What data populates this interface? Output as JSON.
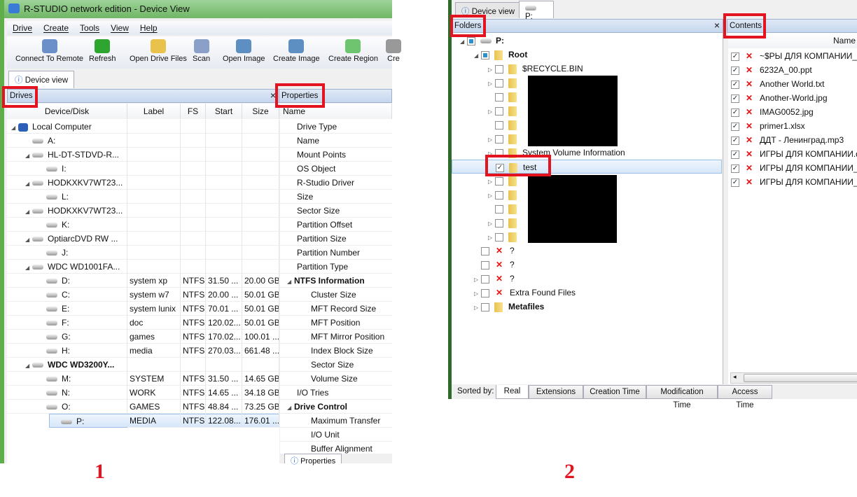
{
  "left": {
    "title": "R-STUDIO network edition - Device View",
    "menu": [
      "Drive",
      "Create",
      "Tools",
      "View",
      "Help"
    ],
    "toolbar": [
      "Connect To Remote",
      "Refresh",
      "Open Drive Files",
      "Scan",
      "Open Image",
      "Create Image",
      "Create Region",
      "Cre"
    ],
    "tab": "Device view",
    "drives_title": "Drives",
    "close": "×",
    "columns": [
      "Device/Disk",
      "Label",
      "FS",
      "Start",
      "Size"
    ],
    "drives": [
      {
        "name": "Local Computer",
        "level": 0,
        "type": "pc",
        "exp": true
      },
      {
        "name": "A:",
        "level": 1,
        "type": "hdd"
      },
      {
        "name": "HL-DT-STDVD-R...",
        "level": 1,
        "type": "hdd",
        "exp": true
      },
      {
        "name": "I:",
        "level": 2,
        "type": "cd"
      },
      {
        "name": "HODKXKV7WT23...",
        "level": 1,
        "type": "hdd",
        "exp": true
      },
      {
        "name": "L:",
        "level": 2,
        "type": "cd"
      },
      {
        "name": "HODKXKV7WT23...",
        "level": 1,
        "type": "hdd",
        "exp": true
      },
      {
        "name": "K:",
        "level": 2,
        "type": "cd"
      },
      {
        "name": "OptiarcDVD RW ...",
        "level": 1,
        "type": "hdd",
        "exp": true
      },
      {
        "name": "J:",
        "level": 2,
        "type": "cd"
      },
      {
        "name": "WDC WD1001FA...",
        "level": 1,
        "type": "hdd",
        "exp": true
      },
      {
        "name": "D:",
        "level": 2,
        "type": "hdd",
        "label": "system xp",
        "fs": "NTFS",
        "start": "31.50 ...",
        "size": "20.00 GB"
      },
      {
        "name": "C:",
        "level": 2,
        "type": "hdd",
        "label": "system w7",
        "fs": "NTFS",
        "start": "20.00 ...",
        "size": "50.01 GB"
      },
      {
        "name": "E:",
        "level": 2,
        "type": "hdd",
        "label": "system lunix",
        "fs": "NTFS",
        "start": "70.01 ...",
        "size": "50.01 GB"
      },
      {
        "name": "F:",
        "level": 2,
        "type": "hdd",
        "label": "doc",
        "fs": "NTFS",
        "start": "120.02...",
        "size": "50.01 GB"
      },
      {
        "name": "G:",
        "level": 2,
        "type": "hdd",
        "label": "games",
        "fs": "NTFS",
        "start": "170.02...",
        "size": "100.01 ..."
      },
      {
        "name": "H:",
        "level": 2,
        "type": "hdd",
        "label": "media",
        "fs": "NTFS",
        "start": "270.03...",
        "size": "661.48 ..."
      },
      {
        "name": "WDC WD3200Y...",
        "level": 1,
        "type": "hdd",
        "exp": true,
        "bold": true
      },
      {
        "name": "M:",
        "level": 2,
        "type": "hdd",
        "label": "SYSTEM",
        "fs": "NTFS",
        "start": "31.50 ...",
        "size": "14.65 GB"
      },
      {
        "name": "N:",
        "level": 2,
        "type": "hdd",
        "label": "WORK",
        "fs": "NTFS",
        "start": "14.65 ...",
        "size": "34.18 GB"
      },
      {
        "name": "O:",
        "level": 2,
        "type": "hdd",
        "label": "GAMES",
        "fs": "NTFS",
        "start": "48.84 ...",
        "size": "73.25 GB"
      },
      {
        "name": "P:",
        "level": 2,
        "type": "hdd",
        "label": "MEDIA",
        "fs": "NTFS",
        "start": "122.08...",
        "size": "176.01 ...",
        "selected": true
      }
    ],
    "properties_title": "Properties",
    "properties_col": "Name",
    "properties": [
      {
        "name": "Drive Type",
        "level": 1
      },
      {
        "name": "Name",
        "level": 1
      },
      {
        "name": "Mount Points",
        "level": 1
      },
      {
        "name": "OS Object",
        "level": 1
      },
      {
        "name": "R-Studio Driver",
        "level": 1
      },
      {
        "name": "Size",
        "level": 1
      },
      {
        "name": "Sector Size",
        "level": 1
      },
      {
        "name": "Partition Offset",
        "level": 1
      },
      {
        "name": "Partition Size",
        "level": 1
      },
      {
        "name": "Partition Number",
        "level": 1
      },
      {
        "name": "Partition Type",
        "level": 1
      },
      {
        "name": "NTFS Information",
        "level": 0,
        "bold": true
      },
      {
        "name": "Cluster Size",
        "level": 2
      },
      {
        "name": "MFT Record Size",
        "level": 2
      },
      {
        "name": "MFT Position",
        "level": 2
      },
      {
        "name": "MFT Mirror Position",
        "level": 2
      },
      {
        "name": "Index Block Size",
        "level": 2
      },
      {
        "name": "Sector Size",
        "level": 2
      },
      {
        "name": "Volume Size",
        "level": 2
      },
      {
        "name": "I/O Tries",
        "level": 1
      },
      {
        "name": "Drive Control",
        "level": 0,
        "bold": true
      },
      {
        "name": "Maximum Transfer",
        "level": 2
      },
      {
        "name": "I/O Unit",
        "level": 2
      },
      {
        "name": "Buffer Alignment",
        "level": 2
      }
    ],
    "bottom_tab": "Properties",
    "figure_number": "1"
  },
  "right": {
    "tabs": [
      "Device view",
      "P:"
    ],
    "folders_title": "Folders",
    "close": "×",
    "tree": [
      {
        "name": "P:",
        "level": 0,
        "icon": "hdd",
        "chk": "partial",
        "bold": true,
        "exp": "open"
      },
      {
        "name": "Root",
        "level": 1,
        "icon": "folder",
        "chk": "partial",
        "bold": true,
        "exp": "open"
      },
      {
        "name": "$RECYCLE.BIN",
        "level": 2,
        "icon": "folder",
        "exp": "closed"
      },
      {
        "name": "",
        "level": 2,
        "icon": "folder",
        "exp": "closed"
      },
      {
        "name": "",
        "level": 2,
        "icon": "folder"
      },
      {
        "name": "",
        "level": 2,
        "icon": "folder",
        "exp": "closed"
      },
      {
        "name": "",
        "level": 2,
        "icon": "folder"
      },
      {
        "name": "",
        "level": 2,
        "icon": "folder",
        "exp": "closed"
      },
      {
        "name": "System Volume Information",
        "level": 2,
        "icon": "folder",
        "exp": "closed"
      },
      {
        "name": "test",
        "level": 2,
        "icon": "folder",
        "chk": "checked",
        "selected": true
      },
      {
        "name": "",
        "level": 2,
        "icon": "folder",
        "exp": "closed"
      },
      {
        "name": "",
        "level": 2,
        "icon": "folder",
        "exp": "closed"
      },
      {
        "name": "",
        "level": 2,
        "icon": "folder"
      },
      {
        "name": "",
        "level": 2,
        "icon": "folder",
        "exp": "closed"
      },
      {
        "name": "",
        "level": 2,
        "icon": "folder",
        "exp": "closed"
      },
      {
        "name": "?",
        "level": 1,
        "icon": "deleted"
      },
      {
        "name": "?",
        "level": 1,
        "icon": "deleted"
      },
      {
        "name": "?",
        "level": 1,
        "icon": "deleted",
        "exp": "closed"
      },
      {
        "name": "Extra Found Files",
        "level": 1,
        "icon": "deleted",
        "exp": "closed"
      },
      {
        "name": "Metafiles",
        "level": 1,
        "icon": "folder",
        "bold": true,
        "exp": "closed"
      }
    ],
    "contents_title": "Contents",
    "contents_col": "Name",
    "contents": [
      "~$PЫ ДЛЯ КОМПАНИИ_з",
      "6232A_00.ppt",
      "Another World.txt",
      "Another-World.jpg",
      "IMAG0052.jpg",
      "primer1.xlsx",
      "ДДТ - Ленинград.mp3",
      "ИГРЫ ДЛЯ КОМПАНИИ.d",
      "ИГРЫ ДЛЯ КОМПАНИИ_",
      "ИГРЫ ДЛЯ КОМПАНИИ_"
    ],
    "sorted_by": "Sorted by:",
    "sort_tabs": [
      "Real",
      "Extensions",
      "Creation Time",
      "Modification Time",
      "Access Time"
    ],
    "figure_number": "2"
  },
  "colors": {
    "highlight": "#e3141f"
  }
}
